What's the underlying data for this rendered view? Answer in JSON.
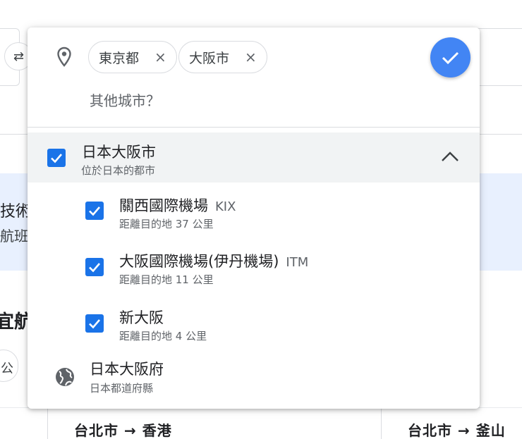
{
  "background": {
    "text_fragment_1": "技術",
    "text_fragment_2": "航班",
    "section_heading_fragment": "宜航",
    "chip_fragment": "公",
    "routes": [
      {
        "origin": "台北市",
        "arrow": "→",
        "destination": "香港"
      },
      {
        "origin": "台北市",
        "arrow": "→",
        "destination": "釜山"
      }
    ]
  },
  "picker": {
    "selected_chips": [
      {
        "label": "東京都",
        "remove": "×"
      },
      {
        "label": "大阪市",
        "remove": "×"
      }
    ],
    "search_placeholder": "其他城市？",
    "confirm_icon": "check-icon",
    "city": {
      "name": "日本大阪市",
      "description": "位於日本的都市",
      "checked": true,
      "expanded": true
    },
    "airports": [
      {
        "name": "關西國際機場",
        "code": "KIX",
        "distance": "距離目的地 37 公里",
        "checked": true
      },
      {
        "name": "大阪國際機場(伊丹機場)",
        "code": "ITM",
        "distance": "距離目的地 11 公里",
        "checked": true
      },
      {
        "name": "新大阪",
        "code": "",
        "distance": "距離目的地 4 公里",
        "checked": true
      }
    ],
    "region": {
      "name": "日本大阪府",
      "description": "日本都道府縣",
      "icon": "globe-icon"
    }
  },
  "colors": {
    "accent": "#1a73e8",
    "confirm_button": "#4285f4",
    "highlight_row": "#f1f3f4",
    "banner": "#e8f0fe"
  }
}
